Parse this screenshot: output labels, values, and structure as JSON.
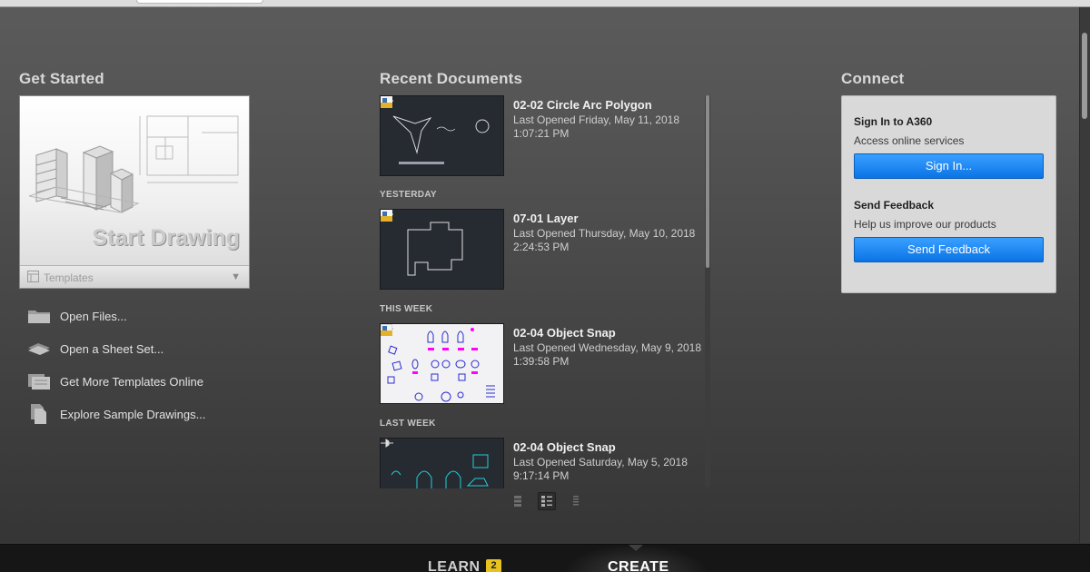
{
  "get_started": {
    "title": "Get Started",
    "start_label": "Start Drawing",
    "templates_label": "Templates",
    "links": [
      {
        "label": "Open Files...",
        "icon": "folder-icon"
      },
      {
        "label": "Open a Sheet Set...",
        "icon": "sheet-set-icon"
      },
      {
        "label": "Get More Templates Online",
        "icon": "templates-online-icon"
      },
      {
        "label": "Explore Sample Drawings...",
        "icon": "sample-drawings-icon"
      }
    ]
  },
  "recent": {
    "title": "Recent Documents",
    "groups": {
      "yesterday": "YESTERDAY",
      "this_week": "THIS WEEK",
      "last_week": "LAST WEEK"
    },
    "docs": [
      {
        "name": "02-02 Circle Arc Polygon",
        "opened": "Last Opened Friday, May 11, 2018",
        "time": "1:07:21 PM"
      },
      {
        "name": "07-01 Layer",
        "opened": "Last Opened Thursday, May 10, 2018",
        "time": "2:24:53 PM"
      },
      {
        "name": "02-04 Object Snap",
        "opened": "Last Opened Wednesday, May 9, 2018",
        "time": "1:39:58 PM"
      },
      {
        "name": "02-04 Object Snap",
        "opened": "Last Opened Saturday, May 5, 2018",
        "time": "9:17:14 PM"
      }
    ]
  },
  "connect": {
    "title": "Connect",
    "signin_heading": "Sign In to A360",
    "signin_sub": "Access online services",
    "signin_button": "Sign In...",
    "feedback_heading": "Send Feedback",
    "feedback_sub": "Help us improve our products",
    "feedback_button": "Send Feedback"
  },
  "bottom": {
    "learn": "LEARN",
    "learn_badge": "2",
    "create": "CREATE"
  },
  "colors": {
    "accent_blue": "#0a74e6",
    "badge_yellow": "#e8c21f",
    "drawing_magenta": "#ff00ff",
    "drawing_cyan": "#22d0d8"
  }
}
